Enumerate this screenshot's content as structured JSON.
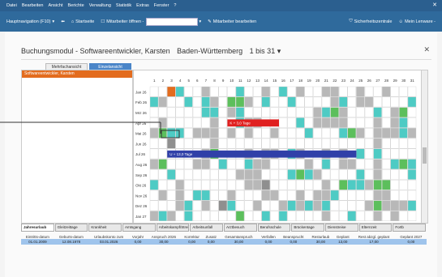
{
  "menu": [
    "Datei",
    "Bearbeiten",
    "Ansicht",
    "Berichte",
    "Verwaltung",
    "Statistik",
    "Extras",
    "Fenster",
    "?"
  ],
  "toolbar": {
    "nav_label": "Hauptnavigation (F10)",
    "home_label": "Startseite",
    "employee_open": "Mitarbeiter öffnen -",
    "employee_edit": "Mitarbeiter bearbeiten",
    "security": "Sicherheitszentrale",
    "account": "Mein Lenware -"
  },
  "module": {
    "title": "Buchungsmodul - Softwareentwickler, Karsten",
    "region": "Baden-Württemberg",
    "range": "1 bis 31"
  },
  "view_tabs": [
    "Mehrfachansicht",
    "Einzelansicht"
  ],
  "selected_person": "Softwareentwickler, Karsten",
  "days": [
    "1",
    "2",
    "3",
    "4",
    "5",
    "6",
    "7",
    "8",
    "9",
    "10",
    "11",
    "12",
    "13",
    "14",
    "15",
    "16",
    "17",
    "18",
    "19",
    "20",
    "21",
    "22",
    "23",
    "24",
    "25",
    "26",
    "27",
    "28",
    "29",
    "30",
    "31"
  ],
  "months": [
    "Jan 26",
    "Feb 26",
    "Mrz 26",
    "Apr 26",
    "Mai 26",
    "Jun 26",
    "Jul 26",
    "Aug 26",
    "Sep 26",
    "Okt 26",
    "Nov 26",
    "Dez 26",
    "Jan 27"
  ],
  "bars": [
    {
      "label": "K + 3,0 Tage",
      "month": 3,
      "from": 10,
      "to": 15,
      "color": "#e02020"
    },
    {
      "label": "U + 13,0 Tage",
      "month": 6,
      "from": 3,
      "to": 24,
      "color": "#3040a8"
    }
  ],
  "bottom_tabs": [
    "Jahresurlaub",
    "Gleitzeittage",
    "Krankheit",
    "Amtsgang",
    "Arbeitskampf/Streik",
    "Arbeitsunfall",
    "Arztbesuch",
    "Berufsschule",
    "Brückentage",
    "Dienstreise",
    "Elternzeit",
    "Fortb"
  ],
  "summary": {
    "headers": [
      "Eintritts-datum",
      "Geburts-datum",
      "Urlaubskonto zum",
      "Vorjahr",
      "Anspruch 2026",
      "Korrektur",
      "Zusatz",
      "Gesamtanspruch",
      "Verfallen",
      "Beansprucht",
      "Resturlaub",
      "Geplant",
      "Rest abzgl. geplant",
      "Geplant 2027"
    ],
    "values": [
      "01.01.2009",
      "12.08.1978",
      "03.01.2026",
      "0,00",
      "30,00",
      "0,00",
      "0,00",
      "30,00",
      "0,00",
      "0,00",
      "30,00",
      "13,00",
      "17,00",
      "0,00"
    ]
  },
  "colors": {
    "accent": "#2f6a9c",
    "teal": "#4ecbc4",
    "green": "#5cbf5c",
    "orange": "#e36c1e",
    "gray": "#b8b8b8",
    "dark_gray": "#8f8f8f"
  }
}
